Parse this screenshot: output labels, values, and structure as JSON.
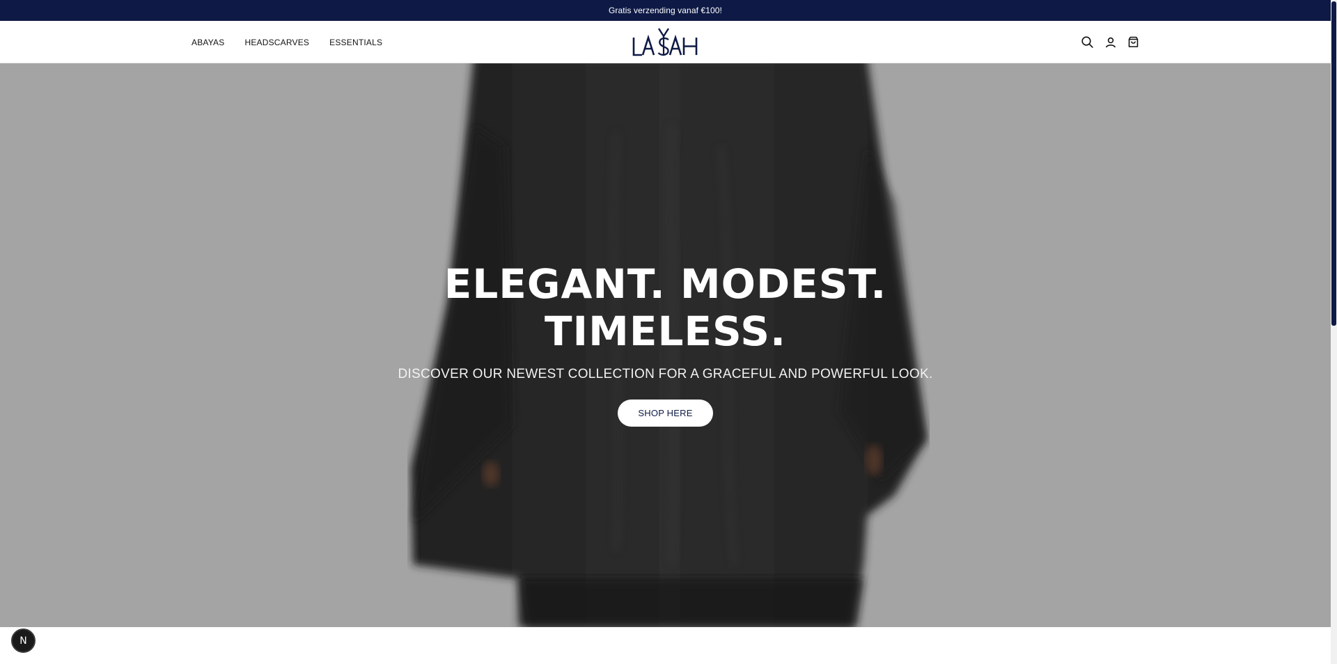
{
  "announcement": {
    "text": "Gratis verzending vanaf €100!"
  },
  "header": {
    "nav": [
      {
        "label": "ABAYAS"
      },
      {
        "label": "HEADSCARVES"
      },
      {
        "label": "ESSENTIALS"
      }
    ],
    "logo_text": "LASAH",
    "icons": [
      "search-icon",
      "account-icon",
      "cart-icon"
    ]
  },
  "hero": {
    "title_line1": "ELEGANT. MODEST.",
    "title_line2": "TIMELESS.",
    "subtitle": "DISCOVER OUR NEWEST COLLECTION FOR A GRACEFUL AND POWERFUL LOOK.",
    "button_label": "SHOP HERE"
  },
  "badge": {
    "letter": "N"
  },
  "colors": {
    "brand_navy": "#0e1a45",
    "hero_background": "#a4a4a4",
    "garment": "#2b2b2b"
  }
}
